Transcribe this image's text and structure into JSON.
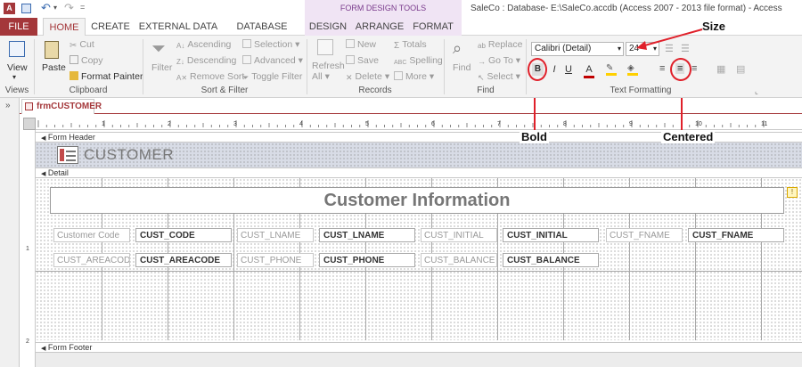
{
  "window": {
    "title": "SaleCo : Database- E:\\SaleCo.accdb (Access 2007 - 2013 file format) - Access"
  },
  "contextual": {
    "group_label": "FORM DESIGN TOOLS"
  },
  "tabs": [
    "FILE",
    "HOME",
    "CREATE",
    "EXTERNAL DATA",
    "DATABASE TOOLS",
    "DESIGN",
    "ARRANGE",
    "FORMAT"
  ],
  "ribbon": {
    "views": {
      "view_label": "View",
      "group": "Views"
    },
    "clipboard": {
      "paste": "Paste",
      "cut": "Cut",
      "copy": "Copy",
      "format_painter": "Format Painter",
      "group": "Clipboard"
    },
    "sort_filter": {
      "filter": "Filter",
      "ascending": "Ascending",
      "descending": "Descending",
      "remove_sort": "Remove Sort",
      "selection": "Selection",
      "advanced": "Advanced",
      "toggle_filter": "Toggle Filter",
      "group": "Sort & Filter"
    },
    "records": {
      "refresh": "Refresh",
      "refresh_all": "All",
      "new": "New",
      "save": "Save",
      "delete": "Delete",
      "totals": "Totals",
      "spelling": "Spelling",
      "more": "More",
      "group": "Records"
    },
    "find": {
      "find": "Find",
      "replace": "Replace",
      "goto": "Go To",
      "select": "Select",
      "group": "Find"
    },
    "text_formatting": {
      "font": "Calibri (Detail)",
      "size": "24",
      "bold": "B",
      "italic": "I",
      "underline": "U",
      "font_color": "A",
      "group": "Text Formatting"
    }
  },
  "doc_tab": {
    "name": "frmCUSTOMER"
  },
  "sections": {
    "header": "Form Header",
    "detail": "Detail",
    "footer": "Form Footer"
  },
  "form": {
    "header_title": "CUSTOMER",
    "info_title": "Customer Information",
    "fields": [
      {
        "label": "Customer Code",
        "control": "CUST_CODE"
      },
      {
        "label": "CUST_LNAME",
        "control": "CUST_LNAME"
      },
      {
        "label": "CUST_INITIAL",
        "control": "CUST_INITIAL"
      },
      {
        "label": "CUST_FNAME",
        "control": "CUST_FNAME"
      },
      {
        "label": "CUST_AREACODE",
        "control": "CUST_AREACODE"
      },
      {
        "label": "CUST_PHONE",
        "control": "CUST_PHONE"
      },
      {
        "label": "CUST_BALANCE",
        "control": "CUST_BALANCE"
      }
    ]
  },
  "ruler": {
    "marks": [
      "1",
      "2",
      "3",
      "4",
      "5",
      "6",
      "7",
      "8",
      "9",
      "10",
      "11"
    ],
    "left_marks": [
      "1",
      "2"
    ]
  },
  "annotations": {
    "size": "Size",
    "bold": "Bold",
    "centered": "Centered"
  },
  "colors": {
    "accent": "#a4373a",
    "contextual": "#f0e4f4",
    "annotation_circle": "#e0202a"
  }
}
